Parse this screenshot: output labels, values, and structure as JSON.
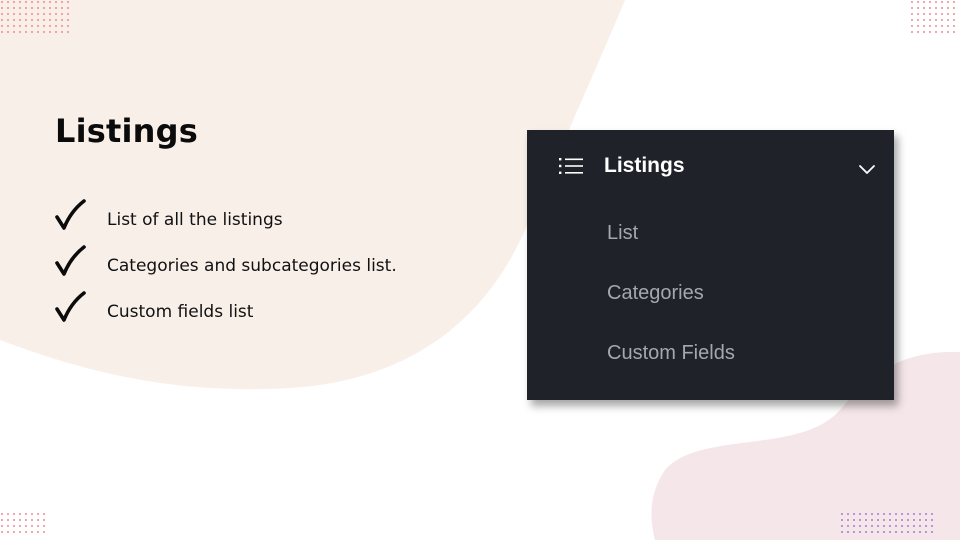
{
  "slide": {
    "title": "Listings",
    "bullets": [
      "List of all the listings",
      "Categories and subcategories list.",
      "Custom fields list"
    ]
  },
  "menu": {
    "section_label": "Listings",
    "section_icon": "list-icon",
    "expand_icon": "chevron-down-icon",
    "expanded": true,
    "items": [
      "List",
      "Categories",
      "Custom Fields"
    ]
  },
  "colors": {
    "panel_background": "#1f2329",
    "panel_header_text": "#ffffff",
    "panel_item_text": "#a4a8ad",
    "blob_peach": "#f9efe9",
    "blob_pink": "#f5e6e9",
    "dots_red": "#f08a93",
    "dots_purple": "#a77ad6"
  }
}
